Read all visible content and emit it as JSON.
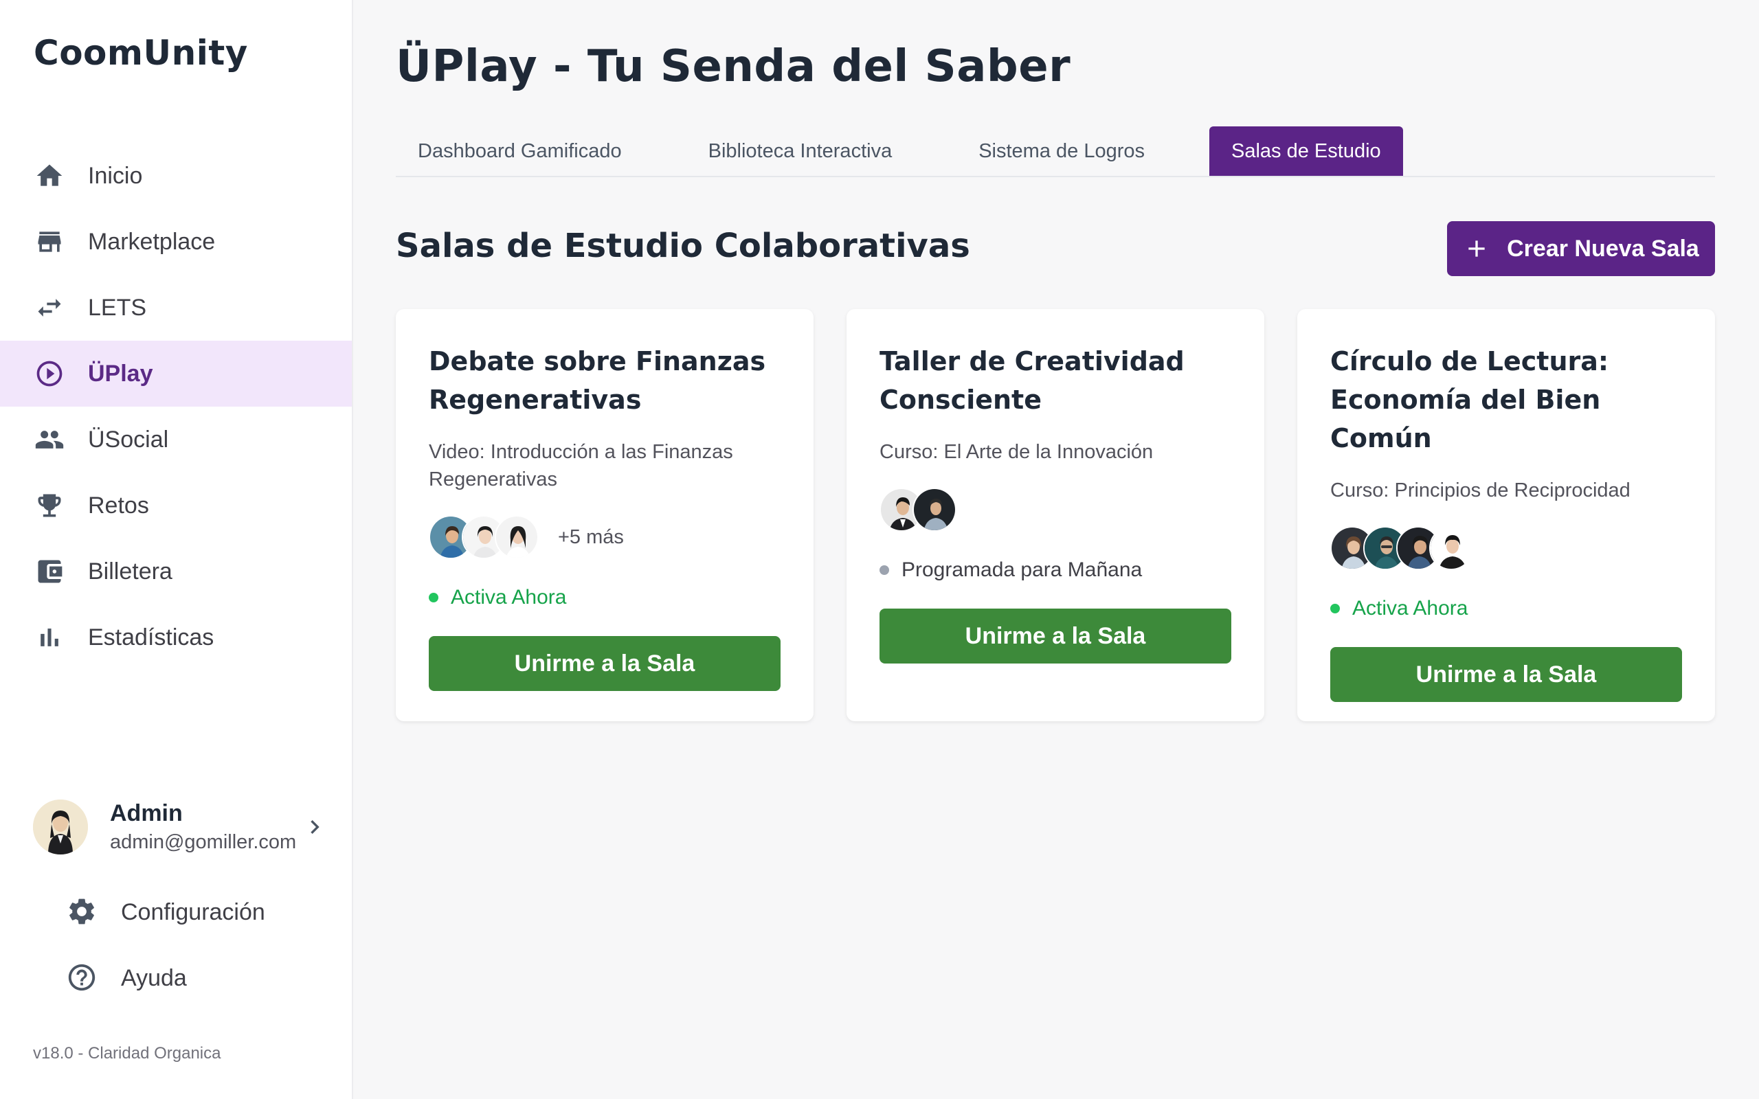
{
  "app": {
    "brand": "CoomUnity",
    "version": "v18.0 - Claridad Organica"
  },
  "sidebar": {
    "items": [
      {
        "label": "Inicio",
        "icon": "home-icon",
        "active": false
      },
      {
        "label": "Marketplace",
        "icon": "store-icon",
        "active": false
      },
      {
        "label": "LETS",
        "icon": "swap-icon",
        "active": false
      },
      {
        "label": "ÜPlay",
        "icon": "play-circle-icon",
        "active": true
      },
      {
        "label": "ÜSocial",
        "icon": "people-icon",
        "active": false
      },
      {
        "label": "Retos",
        "icon": "trophy-icon",
        "active": false
      },
      {
        "label": "Billetera",
        "icon": "wallet-icon",
        "active": false
      },
      {
        "label": "Estadísticas",
        "icon": "bar-chart-icon",
        "active": false
      }
    ],
    "user": {
      "name": "Admin",
      "email": "admin@gomiller.com"
    },
    "settings_label": "Configuración",
    "help_label": "Ayuda"
  },
  "main": {
    "title": "ÜPlay - Tu Senda del Saber",
    "tabs": [
      {
        "label": "Dashboard Gamificado",
        "active": false
      },
      {
        "label": "Biblioteca Interactiva",
        "active": false
      },
      {
        "label": "Sistema de Logros",
        "active": false
      },
      {
        "label": "Salas de Estudio",
        "active": true
      }
    ],
    "section_title": "Salas de Estudio Colaborativas",
    "create_button": "Crear Nueva Sala",
    "rooms": [
      {
        "title": "Debate sobre Finanzas Regenerativas",
        "subtitle": "Video: Introducción a las Finanzas Regenerativas",
        "more": "+5 más",
        "status": "Activa Ahora",
        "button": "Unirme a la Sala"
      },
      {
        "title": "Taller de Creatividad Consciente",
        "subtitle": "Curso: El Arte de la Innovación",
        "more": "",
        "status": "Programada para Mañana",
        "button": "Unirme a la Sala"
      },
      {
        "title": "Círculo de Lectura: Economía del Bien Común",
        "subtitle": "Curso: Principios de Reciprocidad",
        "more": "",
        "status": "Activa Ahora",
        "button": "Unirme a la Sala"
      }
    ]
  },
  "colors": {
    "accent": "#5b2487",
    "active_bg": "#f2e6fb",
    "join": "#3d8a3a",
    "live": "#16a34a"
  }
}
